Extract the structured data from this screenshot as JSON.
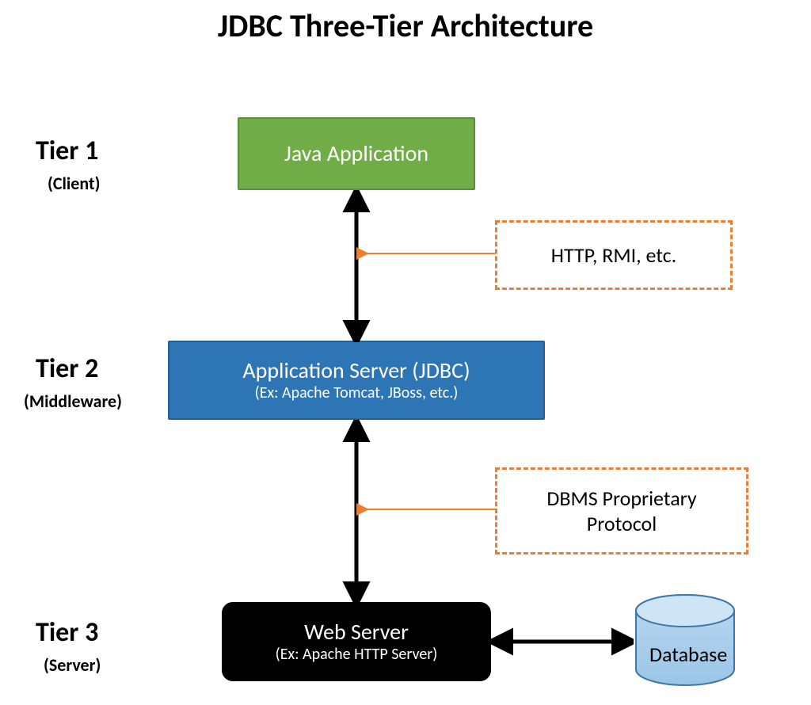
{
  "title": "JDBC Three-Tier Architecture",
  "tiers": [
    {
      "label": "Tier 1",
      "sub": "(Client)"
    },
    {
      "label": "Tier 2",
      "sub": "(Middleware)"
    },
    {
      "label": "Tier 3",
      "sub": "(Server)"
    }
  ],
  "boxes": {
    "tier1": {
      "main": "Java Application"
    },
    "tier2": {
      "main": "Application Server (JDBC)",
      "sub": "(Ex: Apache Tomcat, JBoss, etc.)"
    },
    "tier3": {
      "main": "Web Server",
      "sub": "(Ex: Apache HTTP Server)"
    }
  },
  "callouts": {
    "top": "HTTP, RMI, etc.",
    "bottom": "DBMS Proprietary\nProtocol"
  },
  "database_label": "Database",
  "chart_data": {
    "type": "diagram",
    "nodes": [
      {
        "id": "tier1",
        "label": "Java Application",
        "tier": "Tier 1 (Client)"
      },
      {
        "id": "tier2",
        "label": "Application Server (JDBC)",
        "sub": "Apache Tomcat, JBoss, etc.",
        "tier": "Tier 2 (Middleware)"
      },
      {
        "id": "tier3",
        "label": "Web Server",
        "sub": "Apache HTTP Server",
        "tier": "Tier 3 (Server)"
      },
      {
        "id": "db",
        "label": "Database"
      }
    ],
    "edges": [
      {
        "from": "tier1",
        "to": "tier2",
        "bidirectional": true,
        "annotation": "HTTP, RMI, etc."
      },
      {
        "from": "tier2",
        "to": "tier3",
        "bidirectional": true,
        "annotation": "DBMS Proprietary Protocol"
      },
      {
        "from": "tier3",
        "to": "db",
        "bidirectional": true
      }
    ]
  }
}
